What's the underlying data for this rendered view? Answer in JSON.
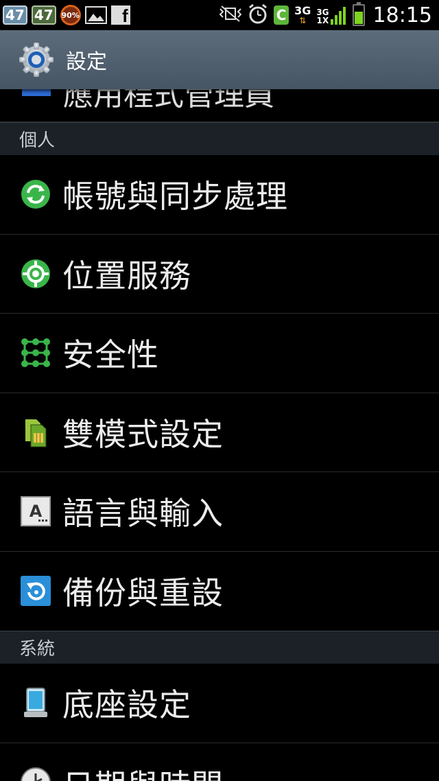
{
  "status_bar": {
    "badge_1": "47",
    "badge_2": "47",
    "battery_percent_badge": "90%",
    "network_3g": "3G",
    "network_3g_small": "3G",
    "network_1x": "1X",
    "carrier_app_letter": "C",
    "time": "18:15",
    "icons": [
      "notification-47-icon",
      "notification-47-icon",
      "battery-saver-90-icon",
      "picture-icon",
      "facebook-icon",
      "vibrate-icon",
      "alarm-icon",
      "carrier-c-icon",
      "3g-data-icon",
      "signal-icon",
      "battery-icon"
    ]
  },
  "title_bar": {
    "title": "設定",
    "icon": "settings-gear-icon"
  },
  "settings_list": {
    "partial_top_item": "應用程式管理員",
    "sections": [
      {
        "header": "個人",
        "items": [
          {
            "label": "帳號與同步處理",
            "icon": "sync-icon"
          },
          {
            "label": "位置服務",
            "icon": "location-icon"
          },
          {
            "label": "安全性",
            "icon": "security-pattern-icon"
          },
          {
            "label": "雙模式設定",
            "icon": "dual-sim-icon"
          },
          {
            "label": "語言與輸入",
            "icon": "keyboard-language-icon"
          },
          {
            "label": "備份與重設",
            "icon": "backup-reset-icon"
          }
        ]
      },
      {
        "header": "系統",
        "items": [
          {
            "label": "底座設定",
            "icon": "dock-icon"
          },
          {
            "label": "日期與時間",
            "icon": "clock-icon"
          }
        ]
      }
    ]
  },
  "colors": {
    "title_bar": "#52616f",
    "section_header": "#1c2128",
    "background": "#000000",
    "accent_green": "#3ab54a"
  }
}
